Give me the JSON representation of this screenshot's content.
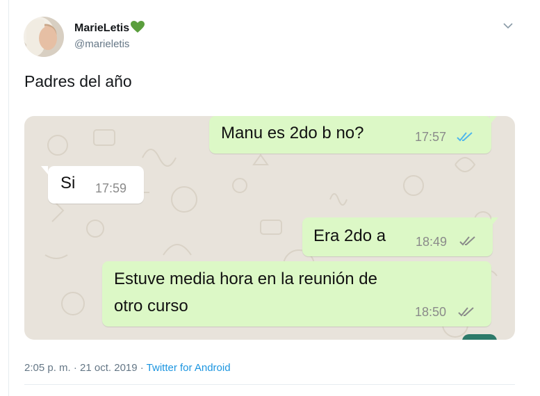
{
  "tweet": {
    "display_name": "MarieLetis",
    "handle": "@marieletis",
    "text": "Padres del año",
    "timestamp": "2:05 p. m. · 21 oct. 2019",
    "separator": " · ",
    "source": "Twitter for Android"
  },
  "chat": {
    "messages": [
      {
        "direction": "out",
        "text": "Manu es 2do b no?",
        "time": "17:57",
        "status": "read"
      },
      {
        "direction": "in",
        "text": "Si",
        "time": "17:59"
      },
      {
        "direction": "out",
        "text": "Era 2do a",
        "time": "18:49",
        "status": "delivered"
      },
      {
        "direction": "out",
        "text_line1": "Estuve media hora en la reunión de",
        "text_line2": "otro curso",
        "time": "18:50",
        "status": "delivered"
      }
    ]
  },
  "colors": {
    "heart": "#5a9e3d",
    "read_ticks": "#4fb6ec",
    "delivered_ticks": "#8a8a8a",
    "outgoing_bubble": "#dcf8c6",
    "link": "#1b95e0"
  }
}
